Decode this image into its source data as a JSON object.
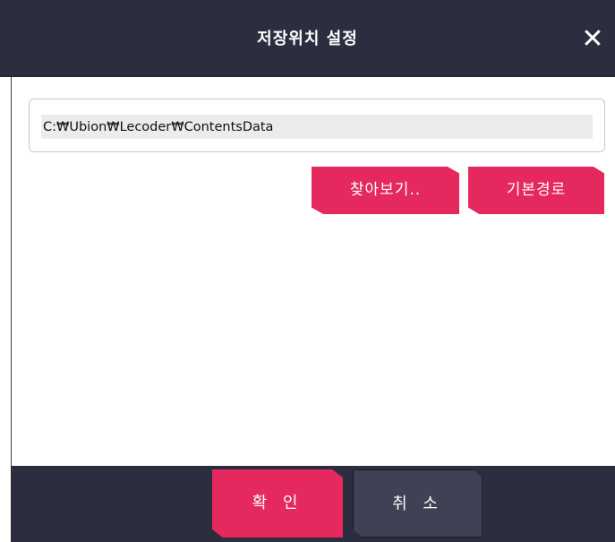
{
  "dialog": {
    "title": "저장위치 설정",
    "close_symbol": "✕"
  },
  "path": {
    "value": "C:₩Ubion₩Lecoder₩ContentsData"
  },
  "buttons": {
    "browse_label": "찾아보기..",
    "default_path_label": "기본경로",
    "confirm_label": "확 인",
    "cancel_label": "취 소"
  },
  "colors": {
    "titlebar": "#2c2e3f",
    "accent_pink": "#e5285e",
    "cancel_button": "#3f4155",
    "input_fill": "#ececec"
  }
}
